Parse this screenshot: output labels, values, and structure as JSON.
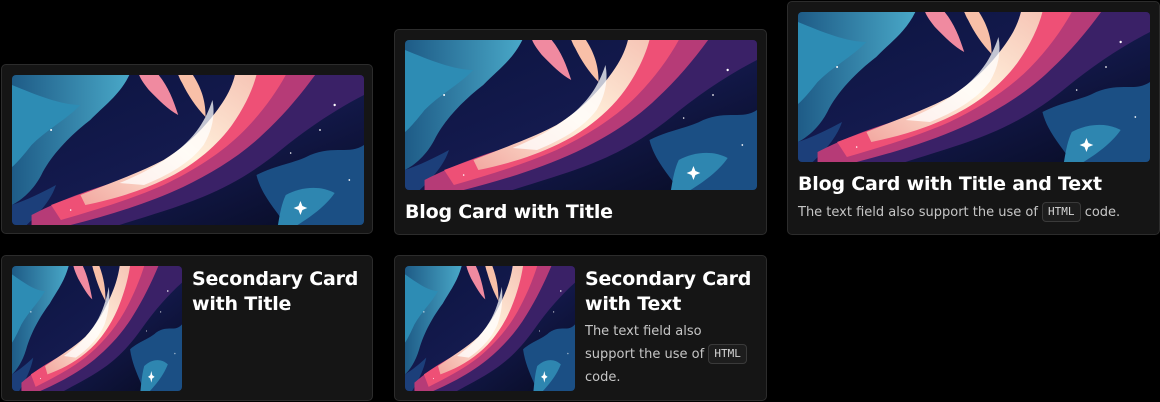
{
  "cards": {
    "image_card": {},
    "blog_title": {
      "title": "Blog Card with Title"
    },
    "blog_title_text": {
      "title": "Blog Card with Title and Text",
      "text_before": "The text field also support the use of",
      "code": "HTML",
      "text_after": "code."
    },
    "secondary_title": {
      "title_line1": "Secondary Card",
      "title_line2": "with Title"
    },
    "secondary_text": {
      "title_line1": "Secondary Card",
      "title_line2": "with Text",
      "text_line1": "The text field also",
      "text_line2": "support the use of",
      "code": "HTML",
      "text_line3": "code."
    }
  }
}
